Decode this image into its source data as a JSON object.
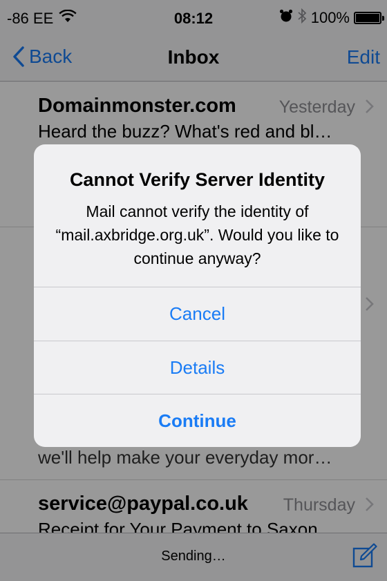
{
  "status_bar": {
    "carrier": "-86 EE",
    "time": "08:12",
    "battery": "100%",
    "battery_level": 1.0,
    "icons": [
      "wifi-icon",
      "alarm-icon",
      "bluetooth-icon",
      "battery-icon"
    ]
  },
  "nav": {
    "back_label": "Back",
    "title": "Inbox",
    "edit_label": "Edit"
  },
  "messages": [
    {
      "sender": "Domainmonster.com",
      "date": "Yesterday",
      "preview": "Heard the buzz? What's red and bl…"
    },
    {
      "preview_partial": "we'll help make your everyday mor…"
    },
    {
      "sender": "service@paypal.co.uk",
      "date": "Thursday",
      "preview": "Receipt for Your Payment to Saxon"
    }
  ],
  "bottom_bar": {
    "status": "Sending…"
  },
  "alert": {
    "title": "Cannot Verify Server Identity",
    "message": "Mail cannot verify the identity of “mail.axbridge.org.uk”. Would you like to continue anyway?",
    "buttons": {
      "cancel": "Cancel",
      "details": "Details",
      "continue": "Continue"
    }
  },
  "colors": {
    "accent": "#1a7cf5",
    "date_gray": "#8e8e93"
  }
}
